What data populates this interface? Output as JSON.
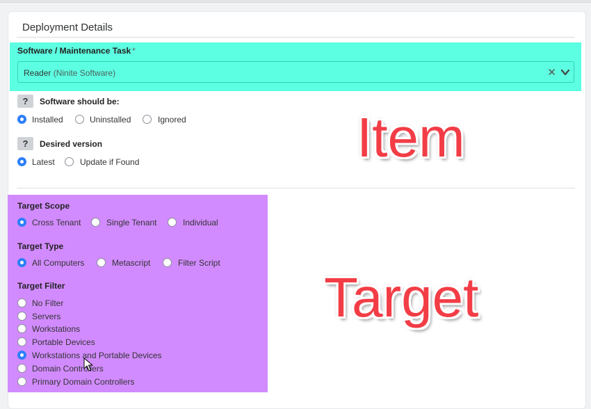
{
  "section": {
    "title": "Deployment Details"
  },
  "software": {
    "label": "Software / Maintenance Task",
    "required_mark": "*",
    "selected_main": "Reader",
    "selected_sub": "(Ninite Software)"
  },
  "software_state": {
    "help": "?",
    "label": "Software should be:",
    "options": [
      "Installed",
      "Uninstalled",
      "Ignored"
    ],
    "selected": "Installed"
  },
  "desired_version": {
    "help": "?",
    "label": "Desired version",
    "options": [
      "Latest",
      "Update if Found"
    ],
    "selected": "Latest"
  },
  "target_scope": {
    "label": "Target Scope",
    "options": [
      "Cross Tenant",
      "Single Tenant",
      "Individual"
    ],
    "selected": "Cross Tenant"
  },
  "target_type": {
    "label": "Target Type",
    "options": [
      "All Computers",
      "Metascript",
      "Filter Script"
    ],
    "selected": "All Computers"
  },
  "target_filter": {
    "label": "Target Filter",
    "options": [
      "No Filter",
      "Servers",
      "Workstations",
      "Portable Devices",
      "Workstations and Portable Devices",
      "Domain Controllers",
      "Primary Domain Controllers"
    ],
    "selected": "Workstations and Portable Devices"
  },
  "annotations": {
    "item": "Item",
    "target": "Target"
  },
  "colors": {
    "highlight_item": "#5cffe1",
    "highlight_target": "#d28bff",
    "radio_selected": "#2d7ff9",
    "annotation_text": "#f23d46"
  },
  "icons": {
    "clear": "close-icon",
    "dropdown": "chevron-down-icon",
    "cursor": "mouse-pointer-icon"
  }
}
